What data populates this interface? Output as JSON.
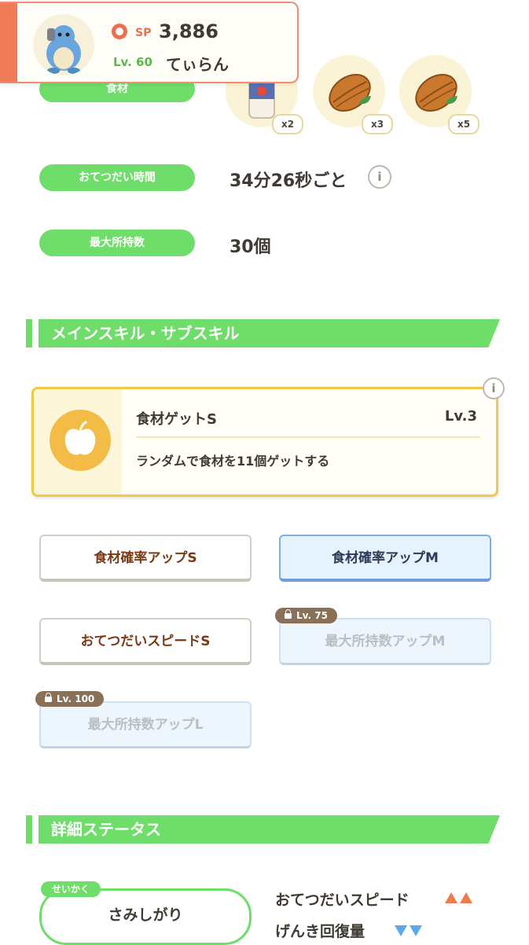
{
  "header": {
    "sp_label": "SP",
    "sp_value": "3,886",
    "level": "Lv. 60",
    "name": "てぃらん"
  },
  "ingredients": {
    "pill_label": "食材",
    "items": [
      {
        "icon": "bottle-icon",
        "count": "x2"
      },
      {
        "icon": "cacao-icon",
        "count": "x3"
      },
      {
        "icon": "cacao-icon",
        "count": "x5"
      }
    ]
  },
  "help_time": {
    "label": "おてつだい時間",
    "value": "34分26秒ごと"
  },
  "max_carry": {
    "label": "最大所持数",
    "value": "30個"
  },
  "skills_section": {
    "title": "メインスキル・サブスキル",
    "main_skill": {
      "name": "食材ゲットS",
      "level": "Lv.3",
      "description": "ランダムで食材を11個ゲットする"
    },
    "sub_skills": [
      {
        "label": "食材確率アップS",
        "state": "unlocked"
      },
      {
        "label": "食材確率アップM",
        "state": "unlocked-blue"
      },
      {
        "label": "おてつだいスピードS",
        "state": "unlocked"
      },
      {
        "label": "最大所持数アップM",
        "state": "locked",
        "lock_level": "Lv. 75"
      },
      {
        "label": "最大所持数アップL",
        "state": "locked",
        "lock_level": "Lv. 100"
      }
    ]
  },
  "details_section": {
    "title": "詳細ステータス",
    "nature_tag": "せいかく",
    "nature": "さみしがり",
    "effects": [
      {
        "label": "おてつだいスピード",
        "direction": "up"
      },
      {
        "label": "げんき回復量",
        "direction": "down"
      }
    ]
  },
  "info_symbol": "i",
  "colors": {
    "accent_green": "#6fdd6a",
    "accent_orange": "#ef7b58",
    "skill_gold": "#f3c842",
    "up_arrow": "#ef7a4c",
    "down_arrow": "#5aa9ee"
  }
}
